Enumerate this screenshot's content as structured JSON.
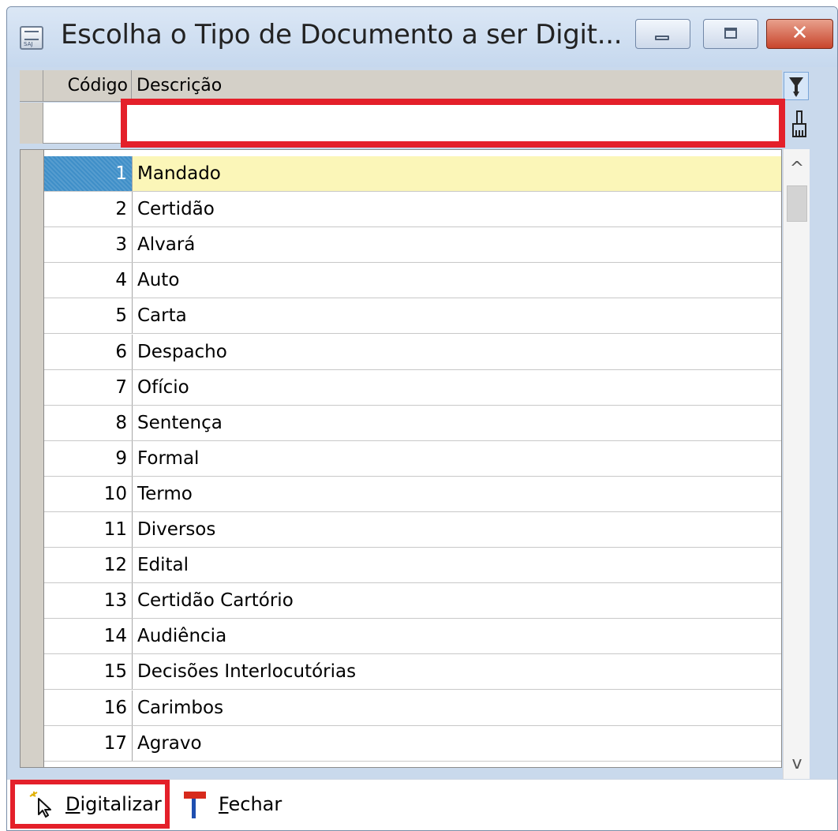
{
  "window": {
    "title": "Escolha o Tipo de Documento a ser Digit...",
    "app_icon_text": "SAJ"
  },
  "columns": {
    "code": "Código",
    "description": "Descrição"
  },
  "filter": {
    "value": "",
    "placeholder": ""
  },
  "rows": [
    {
      "code": "1",
      "description": "Mandado"
    },
    {
      "code": "2",
      "description": "Certidão"
    },
    {
      "code": "3",
      "description": "Alvará"
    },
    {
      "code": "4",
      "description": "Auto"
    },
    {
      "code": "5",
      "description": "Carta"
    },
    {
      "code": "6",
      "description": "Despacho"
    },
    {
      "code": "7",
      "description": "Ofício"
    },
    {
      "code": "8",
      "description": "Sentença"
    },
    {
      "code": "9",
      "description": "Formal"
    },
    {
      "code": "10",
      "description": "Termo"
    },
    {
      "code": "11",
      "description": "Diversos"
    },
    {
      "code": "12",
      "description": "Edital"
    },
    {
      "code": "13",
      "description": "Certidão Cartório"
    },
    {
      "code": "14",
      "description": "Audiência"
    },
    {
      "code": "15",
      "description": "Decisões Interlocutórias"
    },
    {
      "code": "16",
      "description": "Carimbos"
    },
    {
      "code": "17",
      "description": "Agravo"
    }
  ],
  "selected_row": 0,
  "footer": {
    "digitalizar": {
      "mnemonic": "D",
      "rest": "igitalizar"
    },
    "fechar": {
      "mnemonic": "F",
      "rest": "echar"
    }
  },
  "colors": {
    "selection_code": "#3f8fc8",
    "selection_desc": "#fbf6b8",
    "highlight_border": "#e4202a"
  },
  "icons": {
    "window": "app-icon",
    "filter": "filter-icon",
    "clear": "brush-icon",
    "digitalizar": "cursor-sparkle-icon",
    "fechar": "red-flag-icon"
  }
}
